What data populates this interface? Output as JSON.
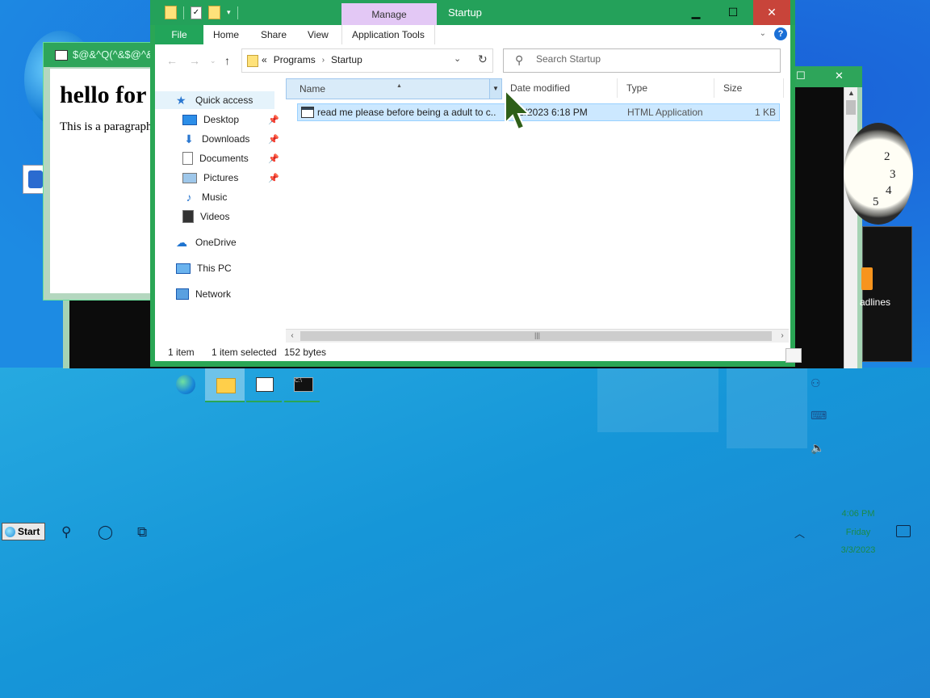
{
  "background_window": {
    "title": "$@&^Q(^&$@^&",
    "heading": "hello for",
    "paragraph": "This is a paragraph"
  },
  "clock_gadget": {
    "numbers": [
      "2",
      "3",
      "4",
      "5"
    ]
  },
  "headlines_gadget": {
    "label": "adlines"
  },
  "explorer": {
    "window_title": "Startup",
    "contextual_tab": "Manage",
    "ribbon_tabs": [
      "File",
      "Home",
      "Share",
      "View",
      "Application Tools"
    ],
    "address": {
      "prefix": "«",
      "crumbs": [
        "Programs",
        "Startup"
      ]
    },
    "search_placeholder": "Search Startup",
    "nav_pane": {
      "quick_access": "Quick access",
      "pinned": [
        "Desktop",
        "Downloads",
        "Documents",
        "Pictures"
      ],
      "unpinned": [
        "Music",
        "Videos"
      ],
      "onedrive": "OneDrive",
      "this_pc": "This PC",
      "network": "Network"
    },
    "columns": [
      "Name",
      "Date modified",
      "Type",
      "Size"
    ],
    "files": [
      {
        "name": "read me please before being a adult to c...",
        "date": "3/2023 6:18 PM",
        "type": "HTML Application",
        "size": "1 KB"
      }
    ],
    "status": {
      "items": "1 item",
      "selected": "1 item selected",
      "size": "152 bytes"
    }
  },
  "taskbar": {
    "start_label": "Start",
    "clock_lines": [
      "4:06 PM",
      "Friday",
      "3/3/2023"
    ]
  },
  "colors": {
    "explorer_accent": "#2aa655",
    "selection": "#cce8ff",
    "close_button": "#c8443a",
    "manage_tab": "#e3c8f5"
  }
}
